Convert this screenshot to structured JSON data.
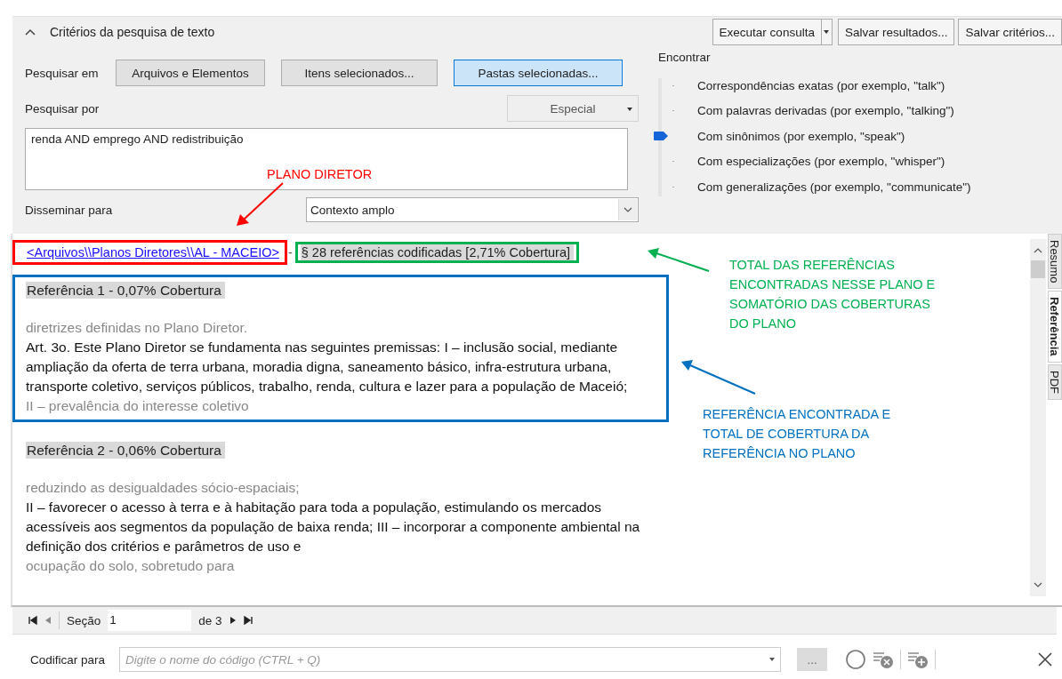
{
  "criteria": {
    "title": "Critérios da pesquisa de texto",
    "expanded": true,
    "actions": [
      "Executar consulta",
      "Salvar resultados...",
      "Salvar critérios..."
    ],
    "search_in": {
      "label": "Pesquisar em",
      "options": [
        {
          "label": "Arquivos e Elementos",
          "selected": false
        },
        {
          "label": "Itens selecionados...",
          "selected": false
        },
        {
          "label": "Pastas selecionadas...",
          "selected": true
        }
      ]
    },
    "search_for": {
      "label": "Pesquisar por",
      "special": "Especial",
      "value": "renda AND emprego AND redistribuição"
    },
    "spread": {
      "label": "Disseminar para",
      "value": "Contexto amplo"
    },
    "find": {
      "label": "Encontrar",
      "options": [
        {
          "label": "Correspondências exatas (por exemplo, \"talk\")",
          "selected": false
        },
        {
          "label": "Com palavras derivadas (por exemplo, \"talking\")",
          "selected": false
        },
        {
          "label": "Com sinônimos (por exemplo, \"speak\")",
          "selected": true
        },
        {
          "label": "Com especializações (por exemplo, \"whisper\")",
          "selected": false
        },
        {
          "label": "Com generalizações (por exemplo, \"communicate\")",
          "selected": false
        }
      ]
    }
  },
  "results": {
    "source_link": "<Arquivos\\\\Planos Diretores\\\\AL - MACEIO>",
    "separator": "-",
    "summary": "§ 28 referências codificadas  [2,71% Cobertura]",
    "references": [
      {
        "heading": "Referência 1 - 0,07% Cobertura",
        "lines": [
          {
            "kind": "context",
            "text": "diretrizes definidas no Plano Diretor."
          },
          {
            "kind": "match",
            "text": "Art. 3o. Este Plano Diretor se fundamenta nas seguintes premissas: I – inclusão social, mediante ampliação da oferta de terra urbana, moradia digna, saneamento básico, infra-estrutura urbana, transporte coletivo, serviços públicos, trabalho, renda, cultura e lazer para a população de Maceió;"
          },
          {
            "kind": "context",
            "text": "II – prevalência do interesse coletivo"
          }
        ]
      },
      {
        "heading": "Referência 2 - 0,06% Cobertura",
        "lines": [
          {
            "kind": "context",
            "text": "reduzindo as desigualdades sócio-espaciais;"
          },
          {
            "kind": "match",
            "text": "II – favorecer o acesso à terra e à habitação para toda a população, estimulando os mercados acessíveis aos segmentos da população de baixa renda; III – incorporar a componente ambiental na definição dos critérios e parâmetros de uso e"
          },
          {
            "kind": "context",
            "text": "ocupação do solo, sobretudo para"
          }
        ]
      }
    ],
    "side_tabs": [
      {
        "label": "Resumo",
        "selected": false
      },
      {
        "label": "Referência",
        "selected": true
      },
      {
        "label": "PDF",
        "selected": false
      }
    ]
  },
  "navigator": {
    "label": "Seção",
    "value": "1",
    "total": "de 3"
  },
  "code_bar": {
    "label": "Codificar para",
    "placeholder": "Digite o nome do código (CTRL + Q)",
    "browse": "..."
  },
  "annotations": [
    {
      "text": "PLANO DIRETOR",
      "color": "#ff0000"
    },
    {
      "text": "TOTAL DAS REFERÊNCIAS ENCONTRADAS NESSE PLANO E SOMATÓRIO DAS COBERTURAS DO PLANO",
      "color": "#00b050"
    },
    {
      "text": "REFERÊNCIA ENCONTRADA E TOTAL DE COBERTURA DA REFERÊNCIA NO PLANO",
      "color": "#0070c0"
    }
  ]
}
